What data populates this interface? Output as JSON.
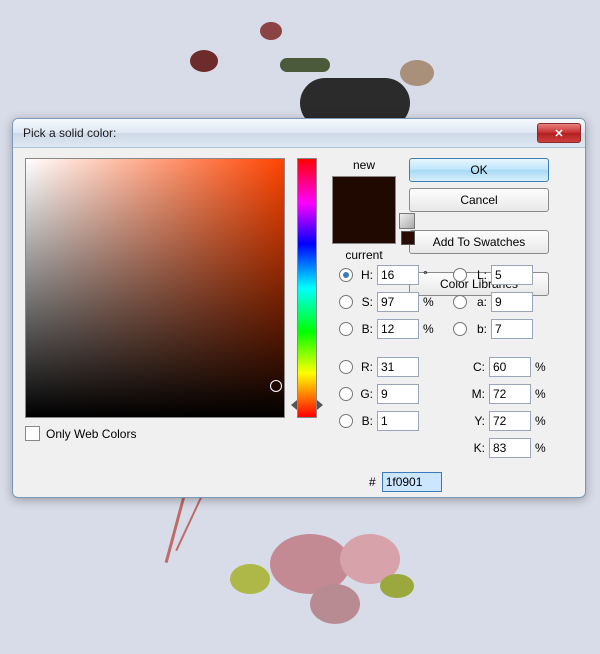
{
  "dialog": {
    "title": "Pick a solid color:",
    "close_label": "✕",
    "only_web_colors_label": "Only Web Colors"
  },
  "swatch": {
    "new_label": "new",
    "current_label": "current",
    "new_color": "#1f0901",
    "current_color": "#1f0901"
  },
  "buttons": {
    "ok": "OK",
    "cancel": "Cancel",
    "add_swatches": "Add To Swatches",
    "color_libraries": "Color Libraries"
  },
  "hsb": {
    "h_label": "H:",
    "h": "16",
    "h_unit": "°",
    "s_label": "S:",
    "s": "97",
    "s_unit": "%",
    "b_label": "B:",
    "b": "12",
    "b_unit": "%"
  },
  "rgb": {
    "r_label": "R:",
    "r": "31",
    "g_label": "G:",
    "g": "9",
    "b_label": "B:",
    "b": "1"
  },
  "lab": {
    "l_label": "L:",
    "l": "5",
    "a_label": "a:",
    "a": "9",
    "b_label": "b:",
    "b": "7"
  },
  "cmyk": {
    "c_label": "C:",
    "c": "60",
    "unit": "%",
    "m_label": "M:",
    "m": "72",
    "y_label": "Y:",
    "y": "72",
    "k_label": "K:",
    "k": "83"
  },
  "hex": {
    "label": "#",
    "value": "1f0901"
  },
  "field_cursor": {
    "x_pct": 97,
    "y_pct": 88
  },
  "hue_cursor": {
    "y_pct": 95.5
  }
}
